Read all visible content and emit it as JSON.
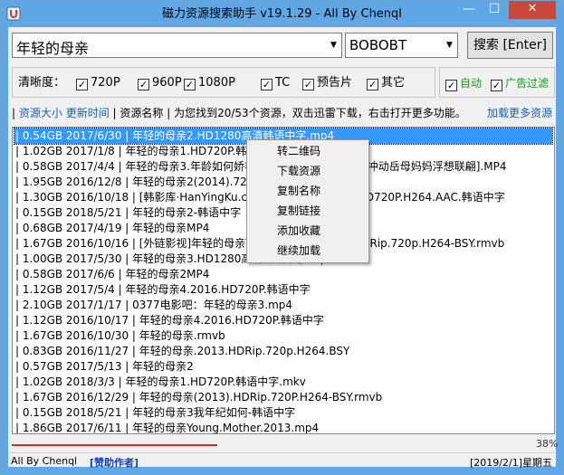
{
  "window": {
    "title": "磁力资源搜索助手 v19.1.29 - All By Chenql",
    "min_label": "—",
    "max_label": "☐",
    "close_label": "✕",
    "titlebar_color": "#5fa8e5"
  },
  "search": {
    "query": "年轻的母亲",
    "engine": "BOBOBT",
    "button_label": "搜索 [Enter]"
  },
  "filters": {
    "resolution_label": "清晰度：",
    "options": [
      {
        "label": "720P",
        "checked": true
      },
      {
        "label": "960P",
        "checked": true
      },
      {
        "label": "1080P",
        "checked": true
      },
      {
        "label": "TC",
        "checked": true
      },
      {
        "label": "预告片",
        "checked": true
      },
      {
        "label": "其它",
        "checked": true
      }
    ],
    "auto_label": "自动",
    "ad_filter_label": "广告过滤"
  },
  "infobar": {
    "sort_size": "资源大小",
    "sort_time": "更新时间",
    "sort_name": "资源名称",
    "message": "为您找到20/53个资源，双击迅雷下载，右击打开更多功能。",
    "load_more": "加载更多资源"
  },
  "results": [
    "| 0.54GB 2017/6/30 | 年轻的母亲2.HD1280高清韩语中字.mp4",
    "| 1.02GB 2017/1/8 | 年轻的母亲1.HD720P.韩语中字.mp4",
    "| 0.58GB 2017/4/4 | 年轻的母亲3.年龄如何娇艳美少妇 美丽小嫂子激情冲动岳母妈妈浮想联翩].MP4",
    "| 1.95GB 2016/12/8 | 年轻的母亲2(2014).720P.韩语中字.mp4",
    "| 1.30GB 2016/10/18 | [韩影库·HanYingKu.com]年轻的母亲.2013.HD720P.H264.AAC.韩语中字",
    "| 0.15GB 2018/5/21 | 年轻的母亲2-韩语中字",
    "| 0.68GB 2017/4/19 | 年轻的母亲MP4",
    "| 1.67GB 2016/10/16 | [外链影视]年轻的母亲Young.Mother.2013.HDRip.720p.H264-BSY.rmvb",
    "| 1.00GB 2017/5/30 | 年轻的母亲3.HD1280高清韩语中字.mp4",
    "| 0.58GB 2017/6/6 | 年轻的母亲2MP4",
    "| 1.12GB 2017/5/4 | 年轻的母亲4.2016.HD720P.韩语中字",
    "| 2.10GB 2017/1/17 | 0377电影吧：年轻的母亲3.mp4",
    "| 1.12GB 2016/10/17 | 年轻的母亲4.2016.HD720P.韩语中字",
    "| 1.67GB 2016/10/30 | 年轻的母亲.rmvb",
    "| 0.83GB 2016/11/27 | 年轻的母亲.2013.HDRip.720p.H264.BSY",
    "| 0.57GB 2017/5/13 | 年轻的母亲2",
    "| 1.02GB 2018/3/3 | 年轻的母亲1.HD720P.韩语中字.mkv",
    "| 1.67GB 2016/12/29 | 年轻的母亲(2013).HDRip.720P.H264-BSY.rmvb",
    "| 0.15GB 2018/5/21 | 年轻的母亲3我年纪如何-韩语中字",
    "| 1.86GB 2017/6/11 | 年轻的母亲Young.Mother.2013.mp4"
  ],
  "context_menu": [
    "转二维码",
    "下载资源",
    "复制名称",
    "复制链接",
    "添加收藏",
    "继续加载"
  ],
  "progress": {
    "percent_label": "38%",
    "value": 0.38,
    "color": "#e52222"
  },
  "status": {
    "left": "All By Chenql",
    "sponsor": "[赞助作者]",
    "date": "[2019/2/1]星期五"
  }
}
